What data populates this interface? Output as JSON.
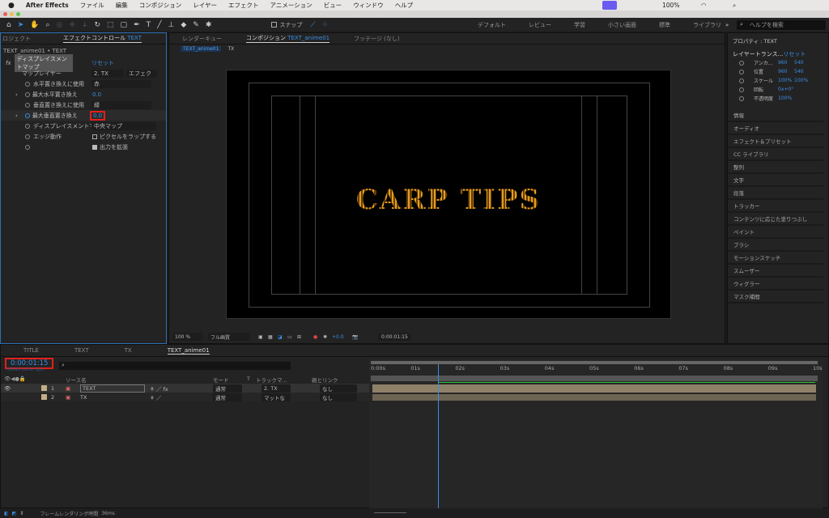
{
  "menubar": {
    "app": "After Effects",
    "items": [
      "ファイル",
      "編集",
      "コンポジション",
      "レイヤー",
      "エフェクト",
      "アニメーション",
      "ビュー",
      "ウィンドウ",
      "ヘルプ"
    ],
    "battery": "100%"
  },
  "toolbar": {
    "snap": "スナップ",
    "workspaces": [
      "デフォルト",
      "レビュー",
      "学習",
      "小さい画面",
      "標準",
      "ライブラリ"
    ],
    "help_placeholder": "ヘルプを検索"
  },
  "effects": {
    "tab_project": "ロジェクト",
    "tab": "エフェクトコントロール",
    "tab_layer": "TEXT",
    "breadcrumb": "TEXT_anime01 • TEXT",
    "effect_name": "ディスプレイスメントマップ",
    "reset": "リセット",
    "props": [
      {
        "label": "マップレイヤー",
        "value": "2. TX",
        "value2": "エフェク"
      },
      {
        "label": "水平置き換えに使用",
        "value": "赤"
      },
      {
        "label": "最大水平置き換え",
        "value": "0.0"
      },
      {
        "label": "垂直置き換えに使用",
        "value": "緑"
      },
      {
        "label": "最大垂直置き換え",
        "value": "0.0"
      },
      {
        "label": "ディスプレイスメントマップ",
        "value": "中央マップ"
      },
      {
        "label": "エッジ動作",
        "value": "ピクセルをラップする"
      },
      {
        "label": "",
        "value": "出力を拡張"
      }
    ]
  },
  "comp": {
    "tabs": [
      "レンダーキュー",
      "コンポジション",
      "フッテージ (なし)"
    ],
    "comp_name": "TEXT_anime01",
    "crumbs": [
      "TEXT_anime01",
      "TX"
    ],
    "canvas_text": "CARP TIPS",
    "zoom": "100 %",
    "quality": "フル画質",
    "exposure": "+0.0",
    "timecode": "0:00:01:15"
  },
  "properties": {
    "title": "プロパティ : TEXT",
    "section": "レイヤートランス...",
    "reset": "リセット",
    "rows": [
      {
        "label": "アンカ...",
        "v1": "960",
        "v2": "540"
      },
      {
        "label": "位置",
        "v1": "960",
        "v2": "540"
      },
      {
        "label": "スケール",
        "v1": "100%",
        "v2": "100%"
      },
      {
        "label": "回転",
        "v1": "0x+0°",
        "v2": ""
      },
      {
        "label": "不透明度",
        "v1": "100%",
        "v2": ""
      }
    ],
    "panels": [
      "情報",
      "オーディオ",
      "エフェクト＆プリセット",
      "CC ライブラリ",
      "整列",
      "文字",
      "段落",
      "トラッカー",
      "コンテンツに応じた塗りつぶし",
      "ペイント",
      "ブラシ",
      "モーションスケッチ",
      "スムーザー",
      "ウィグラー",
      "マスク補間"
    ]
  },
  "timeline": {
    "tabs": [
      "TITLE",
      "TEXT",
      "TX",
      "TEXT_anime01"
    ],
    "timecode": "0:00:01:15",
    "fps": "00045 (29.97 fps)",
    "headers": {
      "source": "ソース名",
      "mode": "モード",
      "t": "T",
      "track": "トラックマ...",
      "parent": "親とリンク"
    },
    "layers": [
      {
        "num": "1",
        "name": "TEXT",
        "mode": "通常",
        "track": "2. TX",
        "parent": "なし"
      },
      {
        "num": "2",
        "name": "TX",
        "mode": "通常",
        "track": "マットな",
        "parent": "なし"
      }
    ],
    "ticks": [
      "0:00s",
      "01s",
      "02s",
      "03s",
      "04s",
      "05s",
      "06s",
      "07s",
      "08s",
      "09s",
      "10s"
    ],
    "playhead_seconds": 1.5,
    "duration_seconds": 10
  },
  "status": {
    "label": "フレームレンダリング時間",
    "value": "36ms"
  },
  "colors": {
    "accent": "#3a8ee6",
    "highlight": "#e0201b",
    "layer_bar": "#8e8168"
  }
}
